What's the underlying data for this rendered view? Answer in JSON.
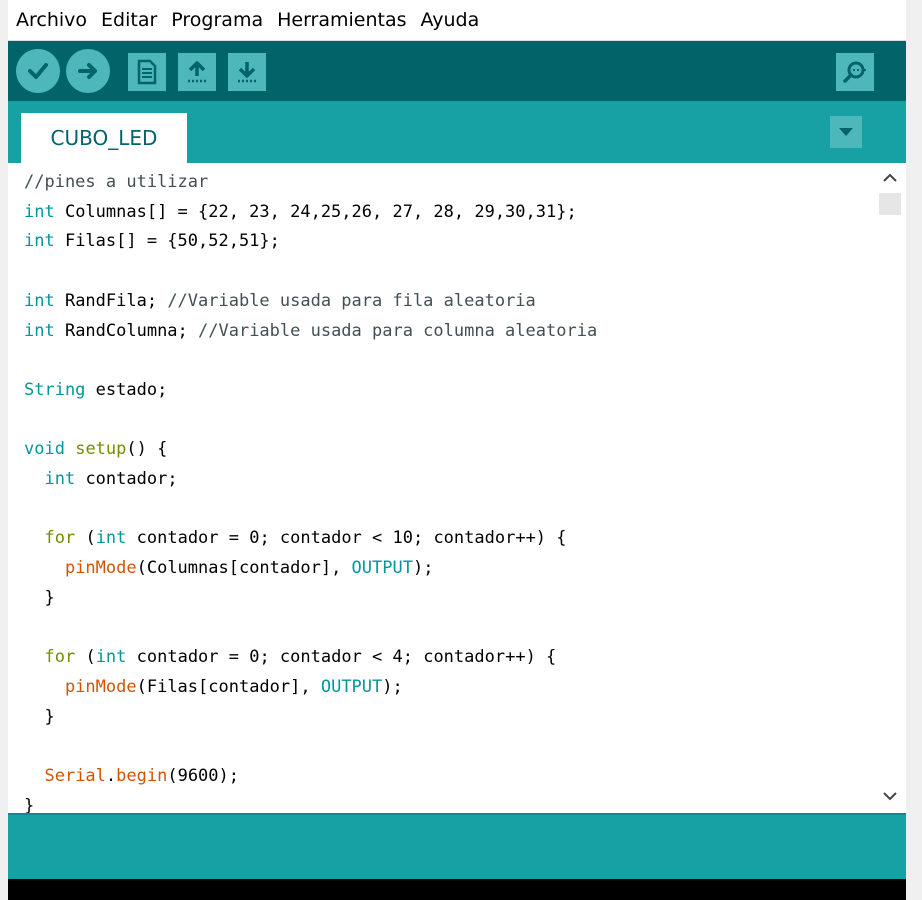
{
  "menubar": {
    "items": [
      "Archivo",
      "Editar",
      "Programa",
      "Herramientas",
      "Ayuda"
    ]
  },
  "toolbar": {
    "buttons": [
      "verify-icon",
      "upload-icon",
      "new-icon",
      "open-icon",
      "save-icon",
      "serial-monitor-icon"
    ]
  },
  "tabs": {
    "active": "CUBO_LED"
  },
  "colors": {
    "toolbar_bg": "#006468",
    "tabbar_bg": "#17a1a5",
    "button_bg": "#4db7bb",
    "keyword": "#00979c",
    "control": "#728e00",
    "function": "#d35400",
    "comment": "#434f54"
  },
  "editor": {
    "lines": [
      [
        {
          "t": "//pines a utilizar",
          "c": "cm"
        }
      ],
      [
        {
          "t": "int",
          "c": "kw"
        },
        {
          "t": " Columnas[] = {22, 23, 24,25,26, 27, 28, 29,30,31};",
          "c": ""
        }
      ],
      [
        {
          "t": "int",
          "c": "kw"
        },
        {
          "t": " Filas[] = {50,52,51};",
          "c": ""
        }
      ],
      [],
      [
        {
          "t": "int",
          "c": "kw"
        },
        {
          "t": " RandFila; ",
          "c": ""
        },
        {
          "t": "//Variable usada para fila aleatoria",
          "c": "cm"
        }
      ],
      [
        {
          "t": "int",
          "c": "kw"
        },
        {
          "t": " RandColumna; ",
          "c": ""
        },
        {
          "t": "//Variable usada para columna aleatoria",
          "c": "cm"
        }
      ],
      [],
      [
        {
          "t": "String",
          "c": "kw"
        },
        {
          "t": " estado;",
          "c": ""
        }
      ],
      [],
      [
        {
          "t": "void",
          "c": "kw"
        },
        {
          "t": " ",
          "c": ""
        },
        {
          "t": "setup",
          "c": "ctl"
        },
        {
          "t": "() {",
          "c": ""
        }
      ],
      [
        {
          "t": "  ",
          "c": ""
        },
        {
          "t": "int",
          "c": "kw"
        },
        {
          "t": " contador;",
          "c": ""
        }
      ],
      [],
      [
        {
          "t": "  ",
          "c": ""
        },
        {
          "t": "for",
          "c": "ctl"
        },
        {
          "t": " (",
          "c": ""
        },
        {
          "t": "int",
          "c": "kw"
        },
        {
          "t": " contador = 0; contador < 10; contador++) {",
          "c": ""
        }
      ],
      [
        {
          "t": "    ",
          "c": ""
        },
        {
          "t": "pinMode",
          "c": "fn"
        },
        {
          "t": "(Columnas[contador], ",
          "c": ""
        },
        {
          "t": "OUTPUT",
          "c": "lit"
        },
        {
          "t": ");",
          "c": ""
        }
      ],
      [
        {
          "t": "  }",
          "c": ""
        }
      ],
      [],
      [
        {
          "t": "  ",
          "c": ""
        },
        {
          "t": "for",
          "c": "ctl"
        },
        {
          "t": " (",
          "c": ""
        },
        {
          "t": "int",
          "c": "kw"
        },
        {
          "t": " contador = 0; contador < 4; contador++) {",
          "c": ""
        }
      ],
      [
        {
          "t": "    ",
          "c": ""
        },
        {
          "t": "pinMode",
          "c": "fn"
        },
        {
          "t": "(Filas[contador], ",
          "c": ""
        },
        {
          "t": "OUTPUT",
          "c": "lit"
        },
        {
          "t": ");",
          "c": ""
        }
      ],
      [
        {
          "t": "  }",
          "c": ""
        }
      ],
      [],
      [
        {
          "t": "  ",
          "c": ""
        },
        {
          "t": "Serial",
          "c": "fn"
        },
        {
          "t": ".",
          "c": ""
        },
        {
          "t": "begin",
          "c": "fn"
        },
        {
          "t": "(9600);",
          "c": ""
        }
      ],
      [
        {
          "t": "}",
          "c": ""
        }
      ]
    ]
  }
}
